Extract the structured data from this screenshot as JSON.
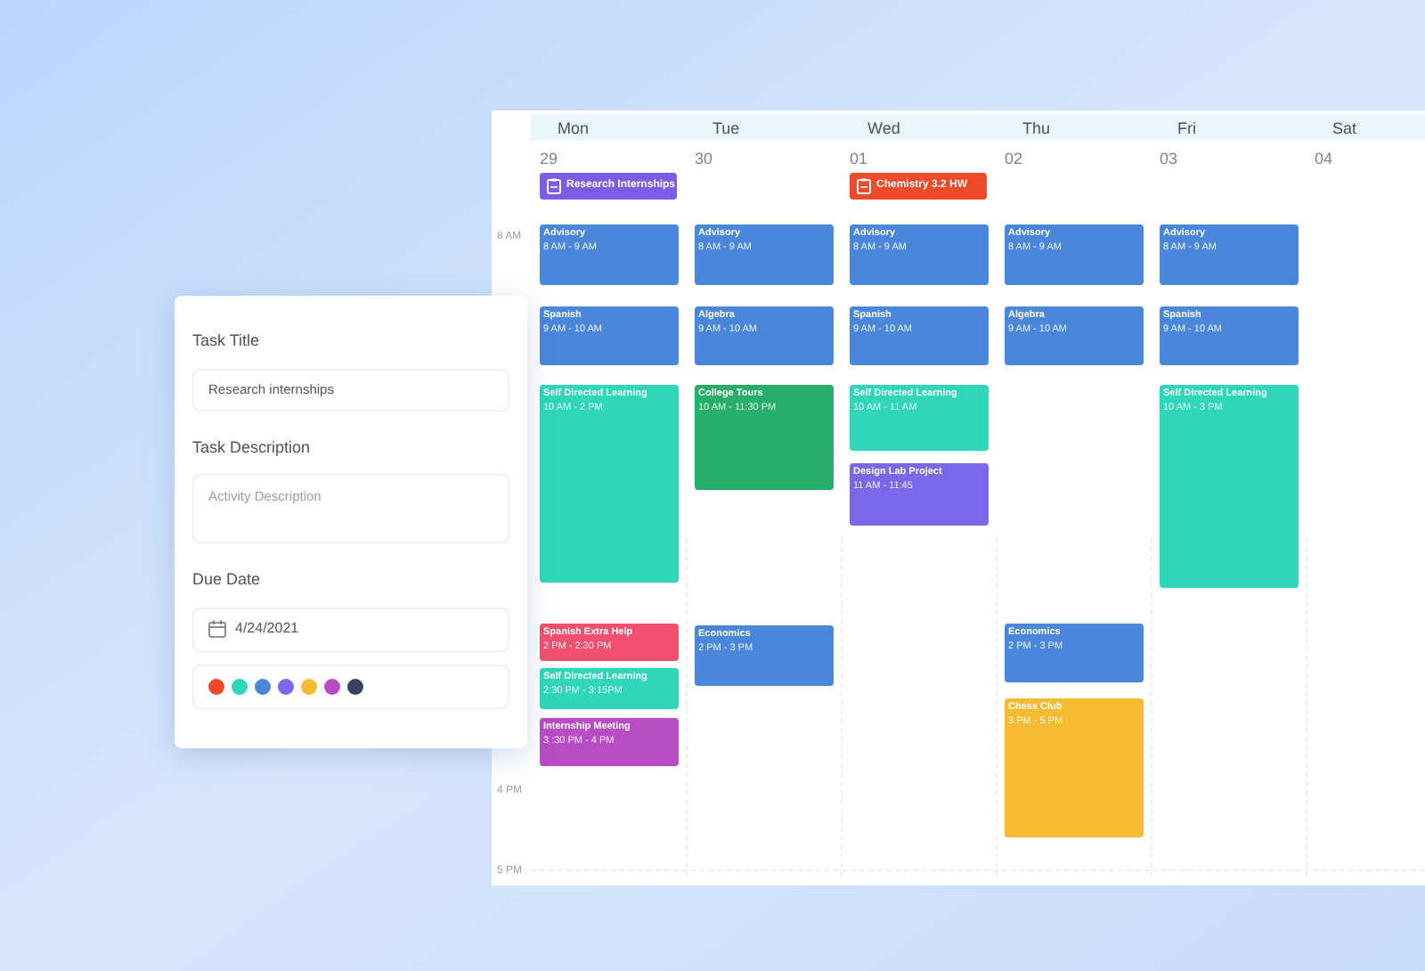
{
  "form": {
    "fields": [
      {
        "kind": "text",
        "label": "Task Title",
        "value": "Research internships"
      },
      {
        "kind": "textarea",
        "label": "Task Description",
        "placeholder": "Activity Description"
      },
      {
        "kind": "date",
        "label": "Due Date",
        "value": "4/24/2021"
      }
    ],
    "colors": [
      {
        "color": "#f04a2a"
      },
      {
        "color": "#2fd6b9"
      },
      {
        "color": "#4a86d9"
      },
      {
        "color": "#7b68e8"
      },
      {
        "color": "#f7bb33"
      },
      {
        "color": "#b84cc4"
      },
      {
        "color": "#3b4060"
      }
    ]
  },
  "calendar": {
    "time_labels": [
      "8 AM",
      "4 PM",
      "5 PM"
    ],
    "days": [
      {
        "name": "Mon",
        "date": "29",
        "all_day": [
          {
            "title": "Research Internships",
            "color": "#7b5ce6"
          }
        ],
        "events": [
          {
            "title": "Advisory",
            "time": "8 AM - 9 AM",
            "color": "#4a86d9"
          },
          {
            "title": "Spanish",
            "time": "9 AM - 10 AM",
            "color": "#4a86d9"
          },
          {
            "title": "Self Directed Learning",
            "time": "10 AM - 2 PM",
            "color": "#2fd6b9"
          },
          {
            "title": "Spanish Extra Help",
            "time": "2 PM - 2:30 PM",
            "color": "#f0506e"
          },
          {
            "title": "Self Directed Learning",
            "time": "2:30 PM - 3:15PM",
            "color": "#2fd6b9"
          },
          {
            "title": "Internship Meeting",
            "time": "3 :30 PM - 4 PM",
            "color": "#b84cc4"
          }
        ]
      },
      {
        "name": "Tue",
        "date": "30",
        "events": [
          {
            "title": "Advisory",
            "time": "8 AM - 9 AM",
            "color": "#4a86d9"
          },
          {
            "title": "Algebra",
            "time": "9 AM - 10 AM",
            "color": "#4a86d9"
          },
          {
            "title": "College Tours",
            "time": "10 AM - 11:30 PM",
            "color": "#27ae6b"
          },
          {
            "title": "Economics",
            "time": "2 PM - 3 PM",
            "color": "#4a86d9"
          }
        ]
      },
      {
        "name": "Wed",
        "date": "01",
        "all_day": [
          {
            "title": "Chemistry 3.2 HW",
            "color": "#f04a2a"
          }
        ],
        "events": [
          {
            "title": "Advisory",
            "time": "8 AM - 9 AM",
            "color": "#4a86d9"
          },
          {
            "title": "Spanish",
            "time": "9 AM - 10 AM",
            "color": "#4a86d9"
          },
          {
            "title": "Self Directed Learning",
            "time": "10 AM - 11 AM",
            "color": "#2fd6b9"
          },
          {
            "title": "Design Lab Project",
            "time": "11 AM - 11:45",
            "color": "#7b68e8"
          }
        ]
      },
      {
        "name": "Thu",
        "date": "02",
        "events": [
          {
            "title": "Advisory",
            "time": "8 AM - 9 AM",
            "color": "#4a86d9"
          },
          {
            "title": "Algebra",
            "time": "9 AM - 10 AM",
            "color": "#4a86d9"
          },
          {
            "title": "Economics",
            "time": "2 PM - 3 PM",
            "color": "#4a86d9"
          },
          {
            "title": "Chess Club",
            "time": "3 PM - 5 PM",
            "color": "#f7bb33"
          }
        ]
      },
      {
        "name": "Fri",
        "date": "03",
        "events": [
          {
            "title": "Advisory",
            "time": "8 AM - 9 AM",
            "color": "#4a86d9"
          },
          {
            "title": "Spanish",
            "time": "9 AM - 10 AM",
            "color": "#4a86d9"
          },
          {
            "title": "Self Directed Learning",
            "time": "10 AM - 3 PM",
            "color": "#2fd6b9"
          }
        ]
      },
      {
        "name": "Sat",
        "date": "04"
      }
    ]
  }
}
